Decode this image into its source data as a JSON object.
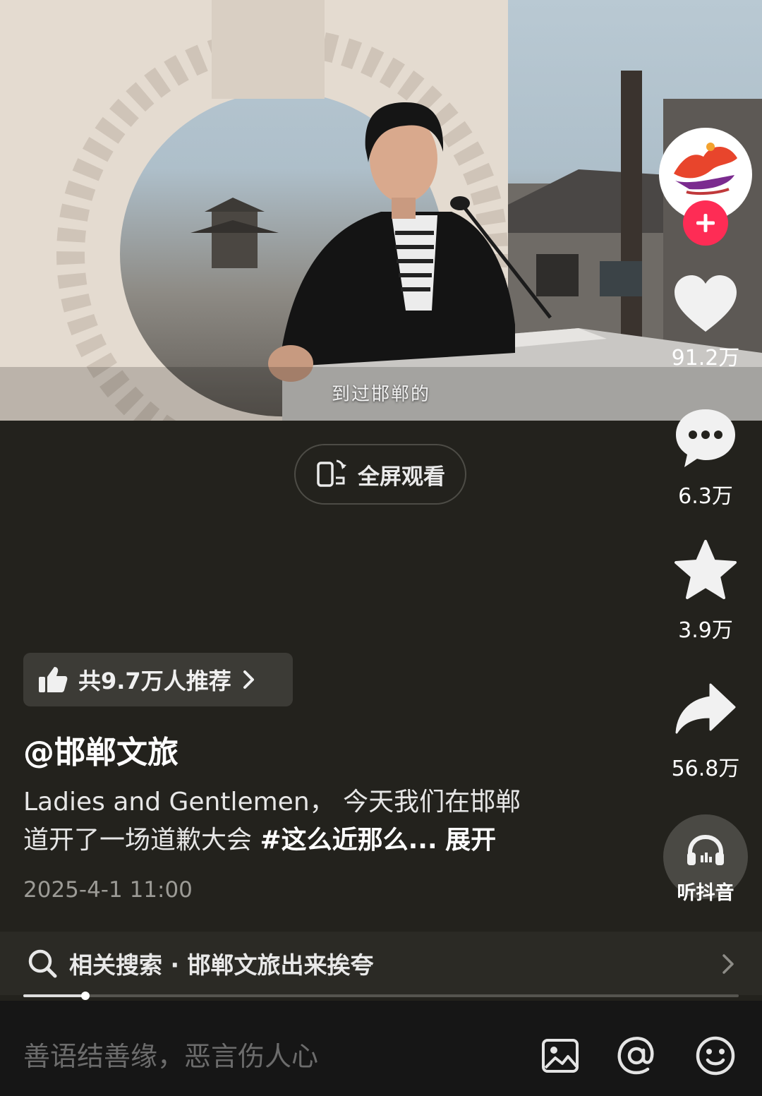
{
  "video": {
    "subtitle": "到过邯郸的"
  },
  "fullscreen": {
    "label": "全屏观看"
  },
  "rail": {
    "likes": "91.2万",
    "comments": "6.3万",
    "favorites": "3.9万",
    "shares": "56.8万",
    "listen": "听抖音"
  },
  "recommend": {
    "label": "共9.7万人推荐"
  },
  "post": {
    "author": "@邯郸文旅",
    "desc_line1": "Ladies and Gentlemen， 今天我们在邯郸",
    "desc_line2_text": "道开了一场道歉大会 ",
    "desc_tag": "#这么近那么...",
    "desc_more": "展开",
    "date": "2025-4-1 11:00"
  },
  "related_search": {
    "label": "相关搜索 · 邯郸文旅出来挨夸"
  },
  "progress": {
    "fraction": 0.087
  },
  "comment_bar": {
    "placeholder": "善语结善缘，恶言伤人心"
  },
  "colors": {
    "accent": "#fe2c55",
    "background": "#23221d"
  },
  "icons": [
    "rotate-screen-icon",
    "heart-icon",
    "comment-icon",
    "star-icon",
    "share-icon",
    "headphones-icon",
    "thumbs-up-icon",
    "chevron-right-icon",
    "search-icon",
    "image-icon",
    "at-icon",
    "emoji-icon",
    "plus-icon"
  ]
}
